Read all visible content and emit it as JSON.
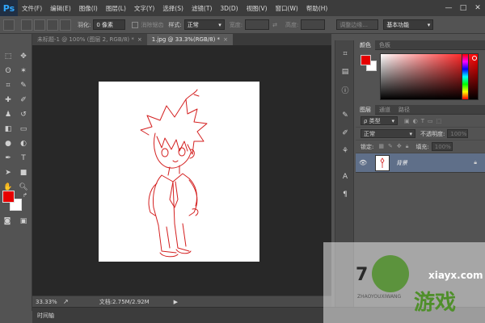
{
  "app": {
    "logo": "Ps"
  },
  "menubar": {
    "items": [
      "文件(F)",
      "编辑(E)",
      "图像(I)",
      "图层(L)",
      "文字(Y)",
      "选择(S)",
      "滤镜(T)",
      "3D(D)",
      "视图(V)",
      "窗口(W)",
      "帮助(H)"
    ],
    "window_controls": [
      "—",
      "□",
      "✕"
    ]
  },
  "options_bar": {
    "feather_label": "羽化:",
    "feather_value": "0 像素",
    "antialias_label": "消除锯齿",
    "style_label": "样式:",
    "style_value": "正常",
    "width_label": "宽度:",
    "height_label": "高度:",
    "refine_edge": "调整边缘...",
    "workspace": "基本功能"
  },
  "document_tabs": [
    {
      "label": "未标题-1 @ 100% (图层 2, RGB/8) *",
      "close": "×",
      "active": false
    },
    {
      "label": "1.jpg @ 33.3%(RGB/8) *",
      "close": "×",
      "active": true
    }
  ],
  "status_bar": {
    "zoom": "33.33%",
    "doc_info": "文档:2.75M/2.92M"
  },
  "timeline": {
    "label": "时间轴"
  },
  "color_panel": {
    "tabs": [
      "颜色",
      "色板"
    ],
    "foreground": "#e60000",
    "background": "#ffffff"
  },
  "layers_panel": {
    "tabs": [
      "图层",
      "通道",
      "路径"
    ],
    "filter_label": "ρ 类型",
    "blend_mode": "正常",
    "opacity_label": "不透明度:",
    "opacity_value": "100%",
    "lock_label": "锁定:",
    "fill_label": "填充:",
    "fill_value": "100%",
    "layers": [
      {
        "name": "背景",
        "visible": true,
        "locked": true
      }
    ]
  },
  "watermark": {
    "brand_text": "游戏",
    "domain_text": "xiayx.com",
    "small_text": "ZHAOYOUXIWANG",
    "digit": "7"
  },
  "colors": {
    "foreground": "#e60000",
    "sketch_line": "#d42020",
    "selected_layer": "#5f6f89",
    "watermark_green": "#4f8f2a"
  }
}
